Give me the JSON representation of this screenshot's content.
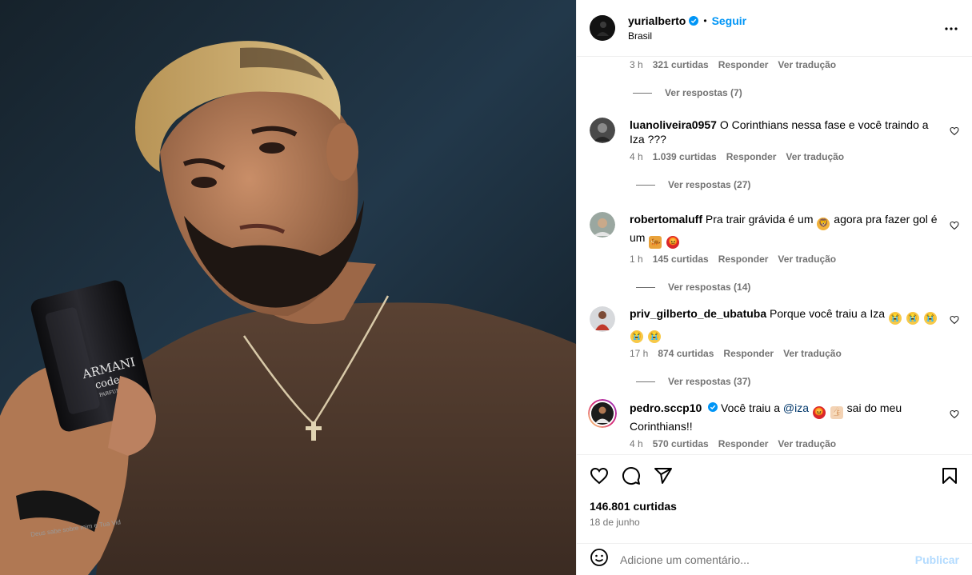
{
  "post": {
    "author": "yurialberto",
    "follow_label": "Seguir",
    "separator": "•",
    "location": "Brasil",
    "photo": {
      "bottle_brand": "ARMANI",
      "bottle_line": "code",
      "bottle_sub": "PARFUM",
      "bracelet_text": "Deus sabe sobre mim e Tua Vid"
    }
  },
  "first_comment_meta": {
    "time": "3 h",
    "likes": "321 curtidas",
    "reply": "Responder",
    "translate": "Ver tradução",
    "view_replies": "Ver respostas (7)"
  },
  "comments": [
    {
      "username": "luanoliveira0957",
      "text": "O Corinthians nessa fase e você traindo a Iza ???",
      "time": "4 h",
      "likes": "1.039 curtidas",
      "reply": "Responder",
      "translate": "Ver tradução",
      "view_replies": "Ver respostas (27)"
    },
    {
      "username": "robertomaluff",
      "text_a": "Pra trair grávida é um",
      "text_b": "agora pra fazer gol é um",
      "emoji_lion": "🦁",
      "emoji_tiger": "🐅",
      "emoji_angry": "😡",
      "time": "1 h",
      "likes": "145 curtidas",
      "reply": "Responder",
      "translate": "Ver tradução",
      "view_replies": "Ver respostas (14)"
    },
    {
      "username": "priv_gilberto_de_ubatuba",
      "text": "Porque você traiu a Iza",
      "emoji_cry": "😭",
      "time": "17 h",
      "likes": "874 curtidas",
      "reply": "Responder",
      "translate": "Ver tradução",
      "view_replies": "Ver respostas (37)"
    },
    {
      "username": "pedro.sccp10",
      "text_a": "Você traiu a",
      "mention": "@iza",
      "text_b": "sai do meu Corinthians!!",
      "emoji_angry": "😡",
      "emoji_thumb": "👍🏻",
      "time": "4 h",
      "likes": "570 curtidas",
      "reply": "Responder",
      "translate": "Ver tradução"
    }
  ],
  "footer": {
    "likes": "146.801 curtidas",
    "date": "18 de junho",
    "comment_placeholder": "Adicione um comentário...",
    "publish_label": "Publicar"
  },
  "colors": {
    "accent": "#0095f6",
    "muted": "#737373",
    "border": "#efefef",
    "publish_disabled": "#b3dbff"
  }
}
